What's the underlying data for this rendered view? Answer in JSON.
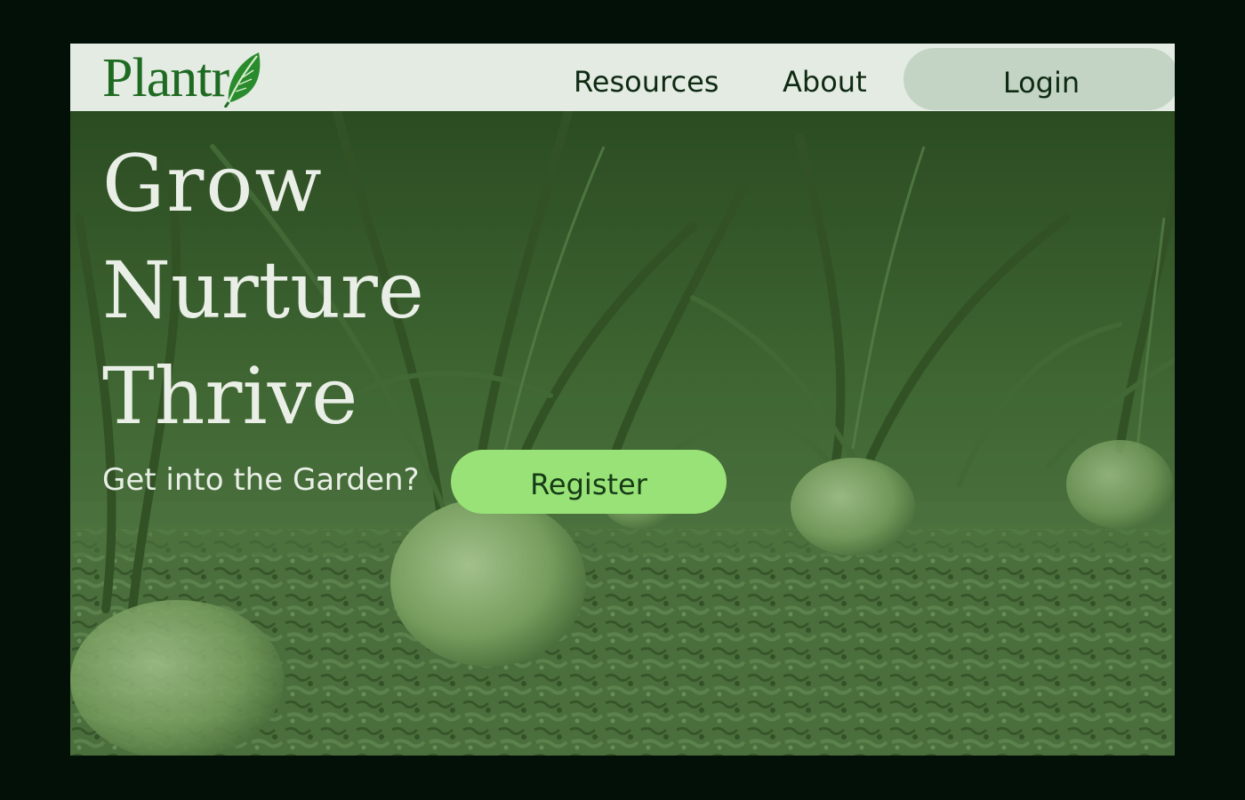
{
  "brand": {
    "name": "Plantr",
    "logo_icon": "leaf-icon",
    "color": "#1f6a22"
  },
  "nav": {
    "resources_label": "Resources",
    "about_label": "About",
    "login_label": "Login"
  },
  "hero": {
    "headline_1": "Grow",
    "headline_2": "Nurture",
    "headline_3": "Thrive",
    "prompt": "Get into the Garden?",
    "register_label": "Register",
    "image": "onion-field-photo"
  },
  "colors": {
    "page_background": "#021007",
    "navbar_background": "#e3ebe3",
    "login_button": "#c3d4c4",
    "register_button": "#98e277",
    "hero_tint": "#4f7a3d",
    "headline_text": "#e9efe6"
  }
}
